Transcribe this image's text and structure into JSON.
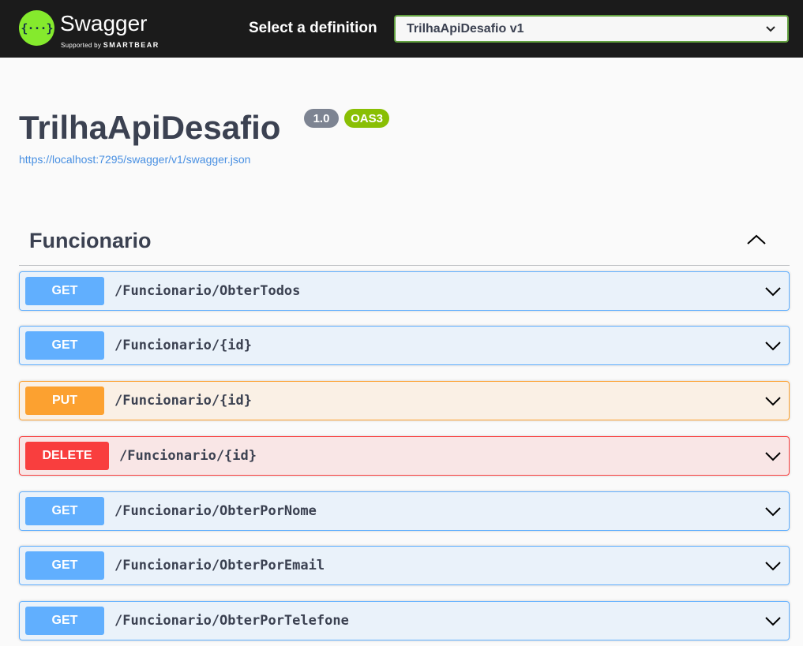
{
  "topbar": {
    "logo_glyph": "{···}",
    "brand": "Swagger",
    "supported_by": "Supported by",
    "smartbear": "SMARTBEAR",
    "select_label": "Select a definition",
    "selected_definition": "TrilhaApiDesafio v1"
  },
  "info": {
    "title": "TrilhaApiDesafio",
    "version": "1.0",
    "oas": "OAS3",
    "url": "https://localhost:7295/swagger/v1/swagger.json"
  },
  "tag": {
    "name": "Funcionario",
    "expanded": true
  },
  "colors": {
    "get": "#61affe",
    "put": "#fca130",
    "delete": "#f93e3e",
    "oas": "#89bf04"
  },
  "operations": [
    {
      "method": "GET",
      "path": "/Funcionario/ObterTodos"
    },
    {
      "method": "GET",
      "path": "/Funcionario/{id}"
    },
    {
      "method": "PUT",
      "path": "/Funcionario/{id}"
    },
    {
      "method": "DELETE",
      "path": "/Funcionario/{id}"
    },
    {
      "method": "GET",
      "path": "/Funcionario/ObterPorNome"
    },
    {
      "method": "GET",
      "path": "/Funcionario/ObterPorEmail"
    },
    {
      "method": "GET",
      "path": "/Funcionario/ObterPorTelefone"
    }
  ]
}
